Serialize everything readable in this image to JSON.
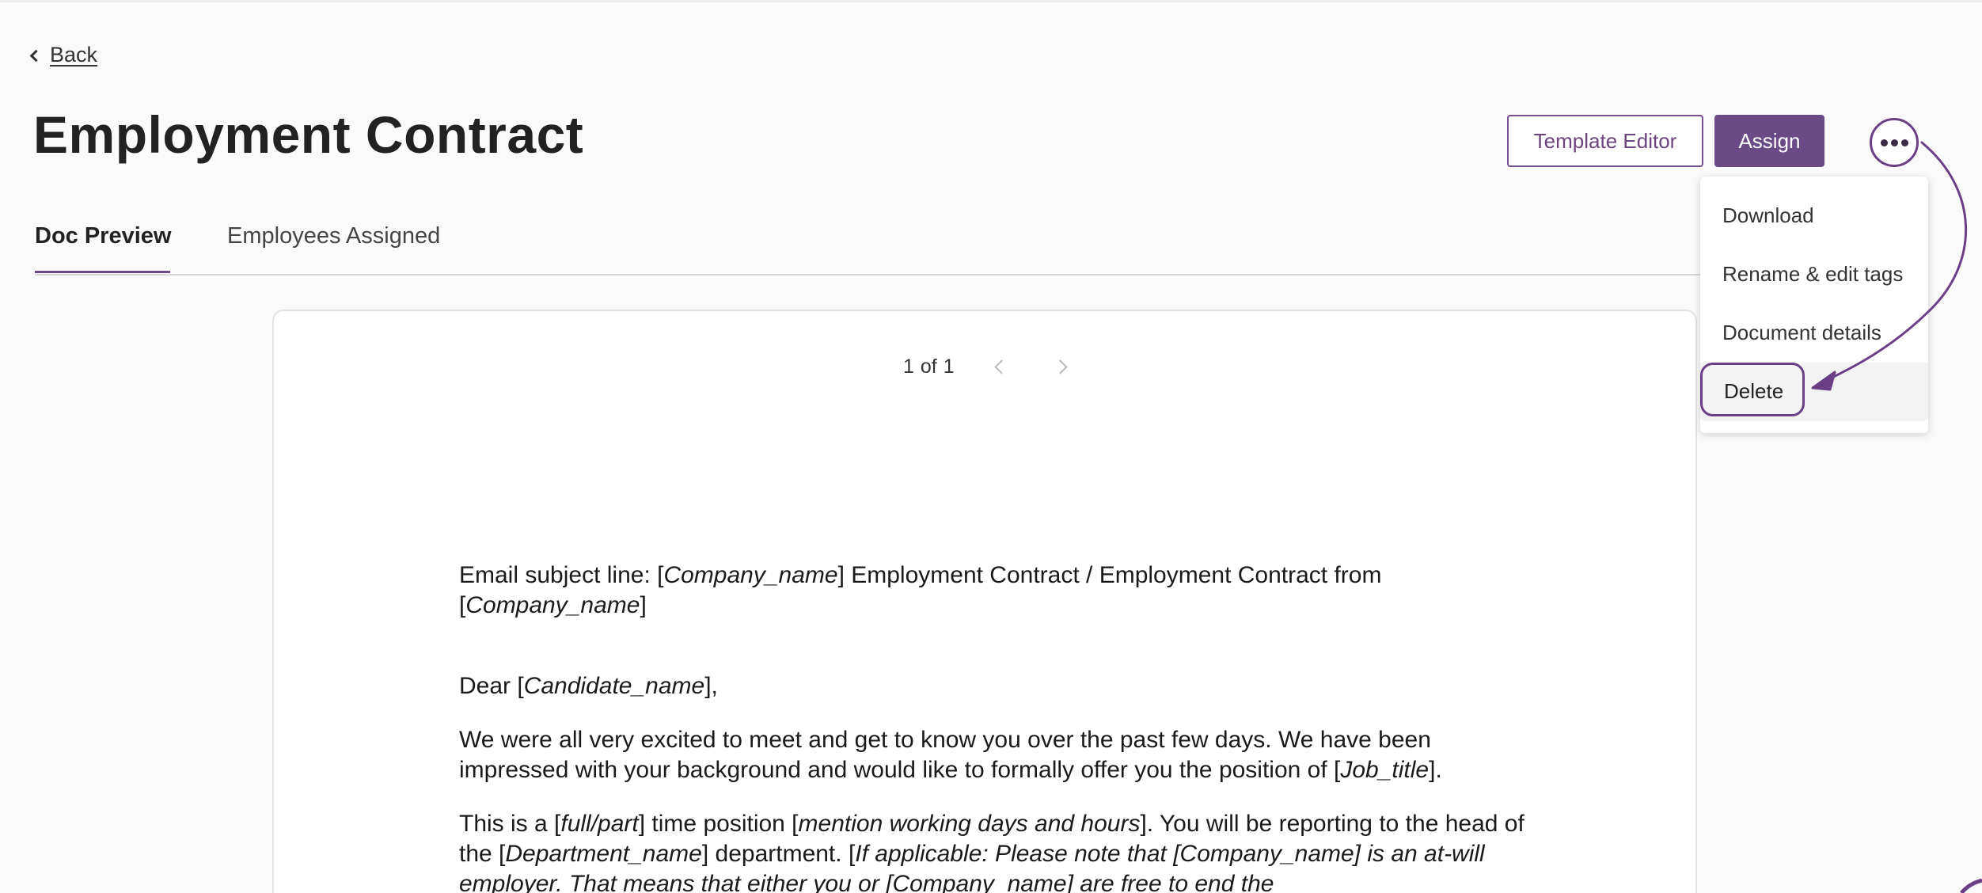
{
  "nav": {
    "back_label": "Back"
  },
  "page": {
    "title": "Employment Contract"
  },
  "actions": {
    "template_editor": "Template Editor",
    "assign": "Assign"
  },
  "tabs": [
    {
      "label": "Doc Preview",
      "active": true
    },
    {
      "label": "Employees Assigned",
      "active": false
    }
  ],
  "menu": {
    "items": [
      "Download",
      "Rename & edit tags",
      "Document details",
      "Delete"
    ],
    "highlighted": "Delete"
  },
  "pager": {
    "current": "1",
    "of": "of",
    "total": "1"
  },
  "document": {
    "p1": {
      "a": "Email subject line: [",
      "b": "Company_name",
      "c": "] Employment Contract / Employment Contract from [",
      "d": "Company_name",
      "e": "]"
    },
    "p2": {
      "a": "Dear [",
      "b": "Candidate_name",
      "c": "],"
    },
    "p3": {
      "a": "We were all very excited to meet and get to know you over the past few days. We have been impressed with your background and would like to formally offer you the position of [",
      "b": "Job_title",
      "c": "]."
    },
    "p4": {
      "a": "This is a [",
      "b": "full/part",
      "c": "] time position [",
      "d": "mention working days and hours",
      "e": "]. You will be reporting to the head of the [",
      "f": "Department_name",
      "g": "] department. [",
      "h": "If applicable: Please note that [Company_name] is an at-will employer. That means that either you or [Company_name] are free to end the"
    }
  },
  "colors": {
    "accent": "#6b4a86",
    "annotation": "#6b3f86"
  },
  "icons": {
    "back": "chevron-left-icon",
    "more": "more-horizontal-icon",
    "prev": "chevron-left-icon",
    "next": "chevron-right-icon"
  }
}
